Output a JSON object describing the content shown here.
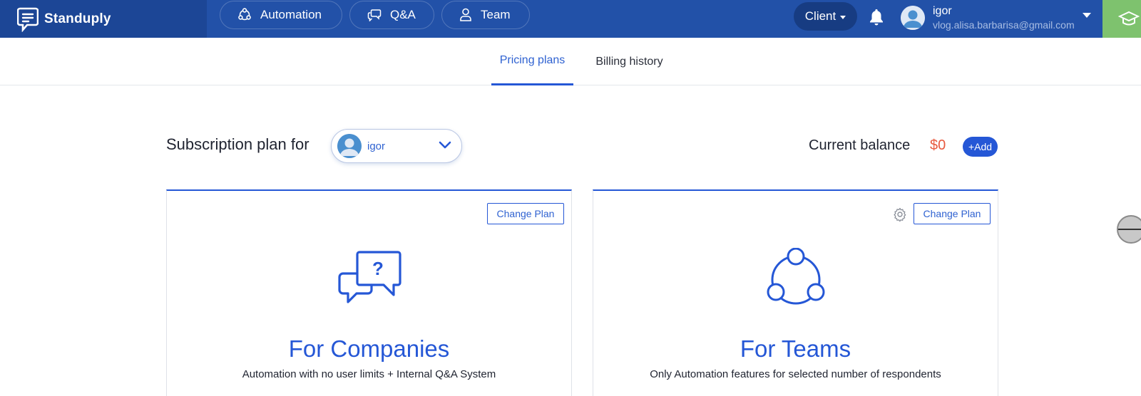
{
  "header": {
    "brand": "Standuply",
    "nav": [
      {
        "label": "Automation",
        "icon": "automation-icon"
      },
      {
        "label": "Q&A",
        "icon": "chat-icon"
      },
      {
        "label": "Team",
        "icon": "user-icon"
      }
    ],
    "client_label": "Client",
    "user": {
      "name": "igor",
      "email": "vlog.alisa.barbarisa@gmail.com"
    }
  },
  "tabs": [
    {
      "label": "Pricing plans",
      "active": true
    },
    {
      "label": "Billing history",
      "active": false
    }
  ],
  "subscription": {
    "label": "Subscription plan for",
    "selected_user": "igor",
    "balance_label": "Current balance",
    "balance_value": "$0",
    "add_label": "+Add"
  },
  "plans": [
    {
      "title": "For Companies",
      "description": "Automation with no user limits + Internal Q&A System",
      "button": "Change Plan",
      "icon": "question-bubbles-icon"
    },
    {
      "title": "For Teams",
      "description": "Only Automation features for selected number of respondents",
      "button": "Change Plan",
      "icon": "team-circle-icon"
    }
  ],
  "colors": {
    "header_bg": "#2251a8",
    "brand_bg": "#1c4696",
    "accent": "#2557d6",
    "balance": "#e85a3f",
    "green_tab": "#7ec26e"
  }
}
